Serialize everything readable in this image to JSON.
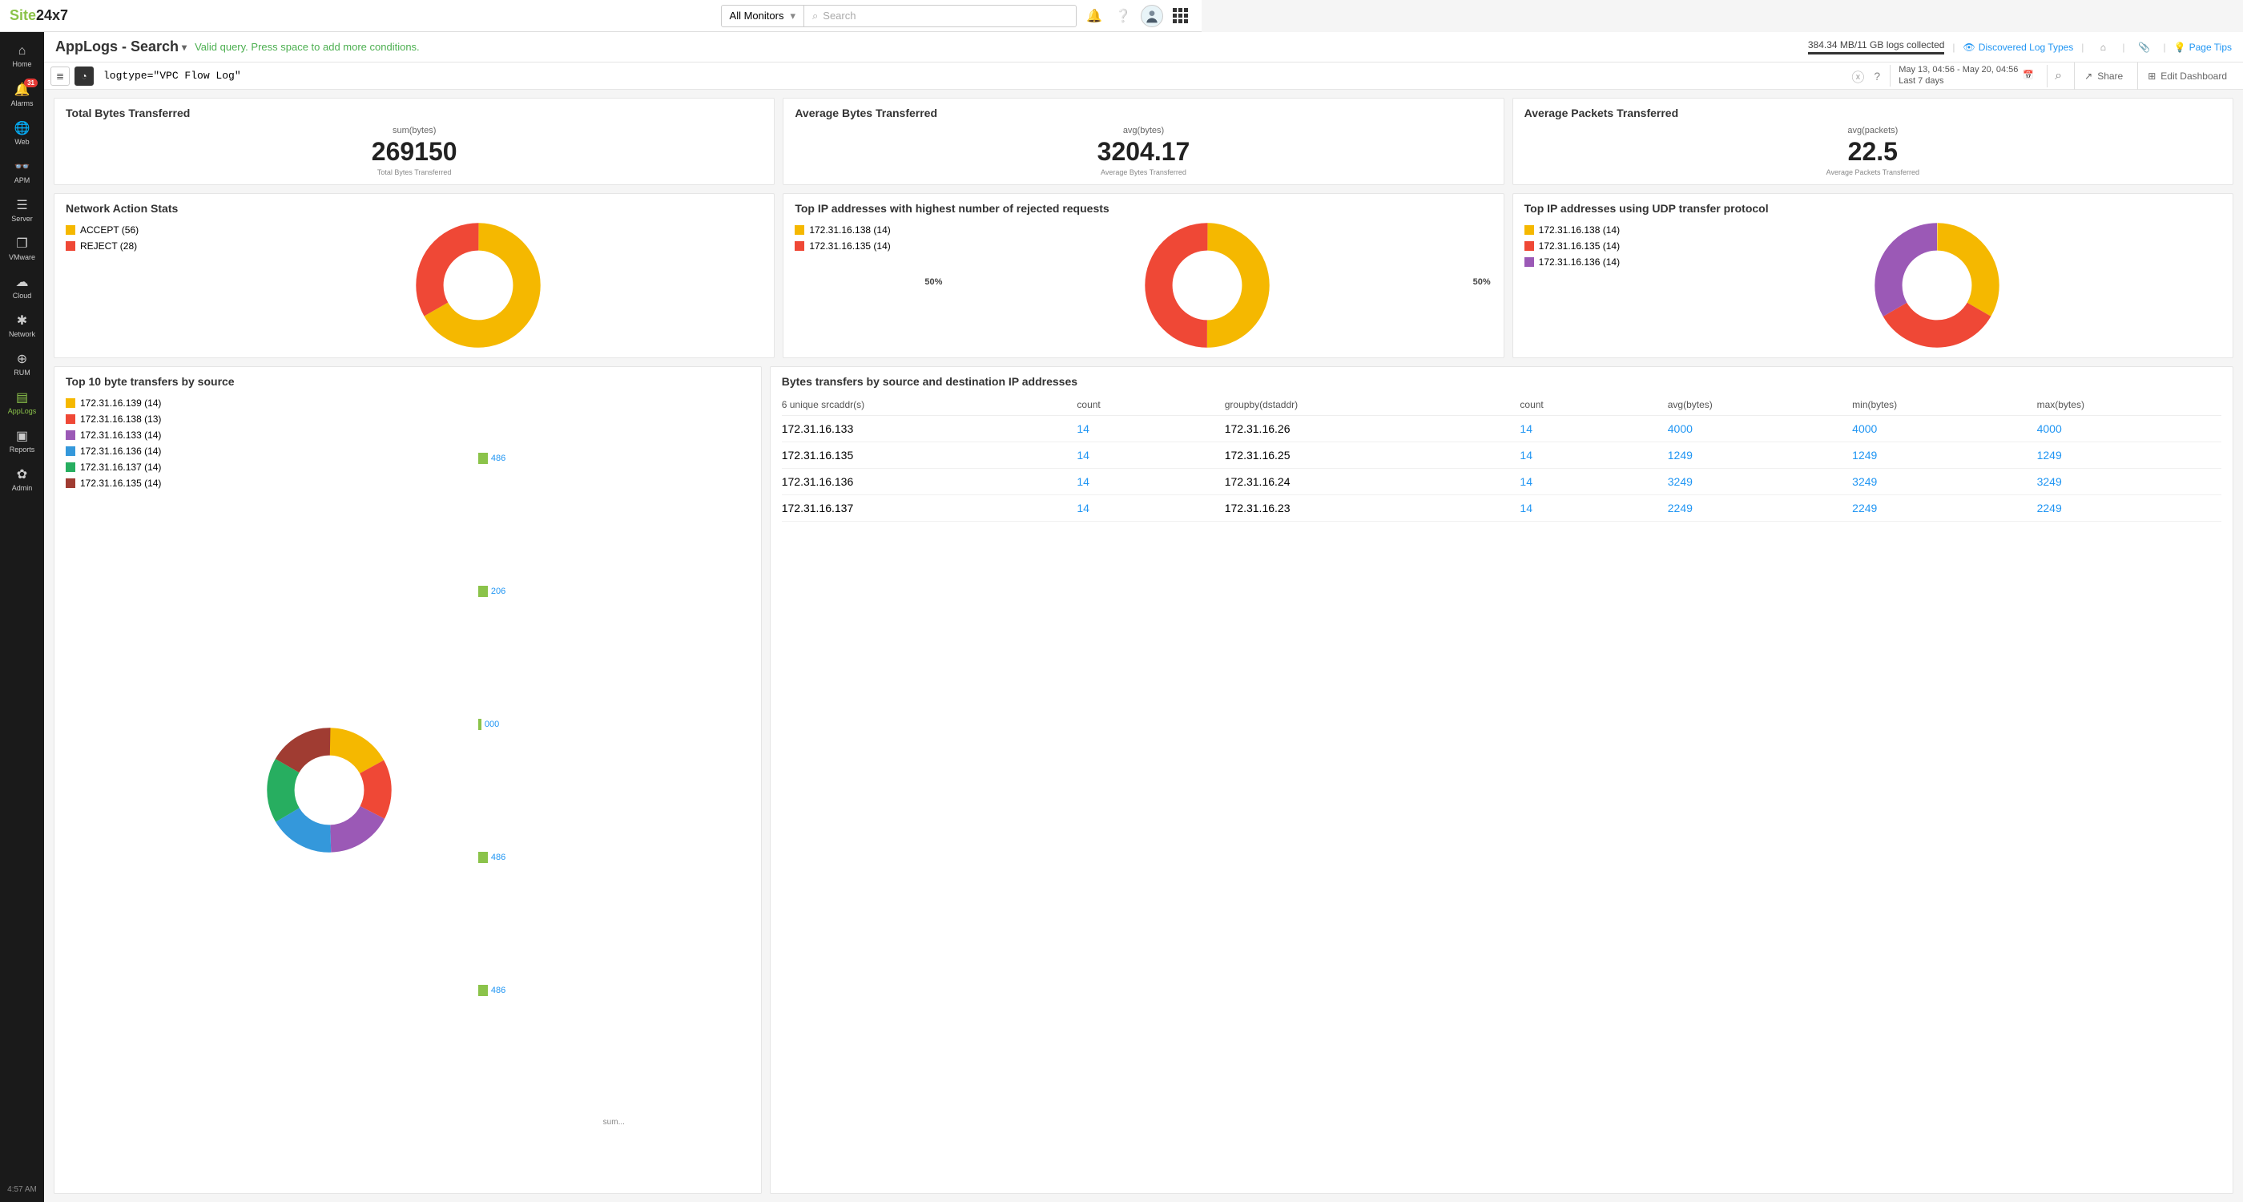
{
  "brand": {
    "p1": "Site",
    "p2": "24x7"
  },
  "topbar": {
    "monitor_select": "All Monitors",
    "search_placeholder": "Search"
  },
  "nav": {
    "items": [
      {
        "label": "Home"
      },
      {
        "label": "Alarms",
        "badge": "31"
      },
      {
        "label": "Web"
      },
      {
        "label": "APM"
      },
      {
        "label": "Server"
      },
      {
        "label": "VMware"
      },
      {
        "label": "Cloud"
      },
      {
        "label": "Network"
      },
      {
        "label": "RUM"
      },
      {
        "label": "AppLogs"
      },
      {
        "label": "Reports"
      },
      {
        "label": "Admin"
      }
    ],
    "time": "4:57 AM"
  },
  "subheader": {
    "title": "AppLogs - Search",
    "valid": "Valid query. Press space to add more conditions.",
    "log_info": "384.34 MB/11 GB logs collected",
    "discovered": "Discovered Log Types",
    "page_tips": "Page Tips"
  },
  "query": {
    "text": "logtype=\"VPC Flow Log\"",
    "date_line1": "May 13, 04:56 - May 20, 04:56",
    "date_line2": "Last 7 days",
    "share": "Share",
    "edit": "Edit Dashboard"
  },
  "kpis": [
    {
      "title": "Total Bytes Transferred",
      "sub": "sum(bytes)",
      "val": "269150",
      "foot": "Total Bytes Transferred"
    },
    {
      "title": "Average Bytes Transferred",
      "sub": "avg(bytes)",
      "val": "3204.17",
      "foot": "Average Bytes Transferred"
    },
    {
      "title": "Average Packets Transferred",
      "sub": "avg(packets)",
      "val": "22.5",
      "foot": "Average Packets Transferred"
    }
  ],
  "donuts": [
    {
      "title": "Network Action Stats",
      "legend": [
        {
          "label": "ACCEPT (56)",
          "color": "#f5b800"
        },
        {
          "label": "REJECT (28)",
          "color": "#ef4836"
        }
      ]
    },
    {
      "title": "Top IP addresses with highest number of rejected requests",
      "legend": [
        {
          "label": "172.31.16.138 (14)",
          "color": "#f5b800"
        },
        {
          "label": "172.31.16.135 (14)",
          "color": "#ef4836"
        }
      ],
      "pct": [
        "50%",
        "50%"
      ]
    },
    {
      "title": "Top IP addresses using UDP transfer protocol",
      "legend": [
        {
          "label": "172.31.16.138 (14)",
          "color": "#f5b800"
        },
        {
          "label": "172.31.16.135 (14)",
          "color": "#ef4836"
        },
        {
          "label": "172.31.16.136 (14)",
          "color": "#9b59b6"
        }
      ],
      "pct": [
        "33.3%"
      ]
    }
  ],
  "sources": {
    "title": "Top 10 byte transfers by source",
    "legend": [
      {
        "label": "172.31.16.139 (14)",
        "color": "#f5b800"
      },
      {
        "label": "172.31.16.138 (13)",
        "color": "#ef4836"
      },
      {
        "label": "172.31.16.133 (14)",
        "color": "#9b59b6"
      },
      {
        "label": "172.31.16.136 (14)",
        "color": "#3498db"
      },
      {
        "label": "172.31.16.137 (14)",
        "color": "#27ae60"
      },
      {
        "label": "172.31.16.135 (14)",
        "color": "#a03c32"
      }
    ],
    "bars": [
      "486",
      "206",
      "000",
      "486",
      "486"
    ],
    "barfoot": "sum..."
  },
  "table": {
    "title": "Bytes transfers by source and destination IP addresses",
    "headers": [
      "6 unique srcaddr(s)",
      "count",
      "groupby(dstaddr)",
      "count",
      "avg(bytes)",
      "min(bytes)",
      "max(bytes)"
    ],
    "rows": [
      {
        "src": "172.31.16.133",
        "c1": "14",
        "dst": "172.31.16.26",
        "c2": "14",
        "avg": "4000",
        "min": "4000",
        "max": "4000"
      },
      {
        "src": "172.31.16.135",
        "c1": "14",
        "dst": "172.31.16.25",
        "c2": "14",
        "avg": "1249",
        "min": "1249",
        "max": "1249"
      },
      {
        "src": "172.31.16.136",
        "c1": "14",
        "dst": "172.31.16.24",
        "c2": "14",
        "avg": "3249",
        "min": "3249",
        "max": "3249"
      },
      {
        "src": "172.31.16.137",
        "c1": "14",
        "dst": "172.31.16.23",
        "c2": "14",
        "avg": "2249",
        "min": "2249",
        "max": "2249"
      }
    ]
  },
  "chart_data": [
    {
      "type": "kpi",
      "title": "Total Bytes Transferred",
      "metric": "sum(bytes)",
      "value": 269150
    },
    {
      "type": "kpi",
      "title": "Average Bytes Transferred",
      "metric": "avg(bytes)",
      "value": 3204.17
    },
    {
      "type": "kpi",
      "title": "Average Packets Transferred",
      "metric": "avg(packets)",
      "value": 22.5
    },
    {
      "type": "pie",
      "title": "Network Action Stats",
      "series": [
        {
          "name": "ACCEPT",
          "value": 56
        },
        {
          "name": "REJECT",
          "value": 28
        }
      ]
    },
    {
      "type": "pie",
      "title": "Top IP addresses with highest number of rejected requests",
      "series": [
        {
          "name": "172.31.16.138",
          "value": 14
        },
        {
          "name": "172.31.16.135",
          "value": 14
        }
      ]
    },
    {
      "type": "pie",
      "title": "Top IP addresses using UDP transfer protocol",
      "series": [
        {
          "name": "172.31.16.138",
          "value": 14
        },
        {
          "name": "172.31.16.135",
          "value": 14
        },
        {
          "name": "172.31.16.136",
          "value": 14
        }
      ]
    },
    {
      "type": "pie",
      "title": "Top 10 byte transfers by source",
      "series": [
        {
          "name": "172.31.16.139",
          "value": 14
        },
        {
          "name": "172.31.16.138",
          "value": 13
        },
        {
          "name": "172.31.16.133",
          "value": 14
        },
        {
          "name": "172.31.16.136",
          "value": 14
        },
        {
          "name": "172.31.16.137",
          "value": 14
        },
        {
          "name": "172.31.16.135",
          "value": 14
        }
      ]
    },
    {
      "type": "table",
      "title": "Bytes transfers by source and destination IP addresses",
      "columns": [
        "srcaddr",
        "count",
        "dstaddr",
        "count",
        "avg(bytes)",
        "min(bytes)",
        "max(bytes)"
      ],
      "rows": [
        [
          "172.31.16.133",
          14,
          "172.31.16.26",
          14,
          4000,
          4000,
          4000
        ],
        [
          "172.31.16.135",
          14,
          "172.31.16.25",
          14,
          1249,
          1249,
          1249
        ],
        [
          "172.31.16.136",
          14,
          "172.31.16.24",
          14,
          3249,
          3249,
          3249
        ],
        [
          "172.31.16.137",
          14,
          "172.31.16.23",
          14,
          2249,
          2249,
          2249
        ]
      ]
    }
  ]
}
